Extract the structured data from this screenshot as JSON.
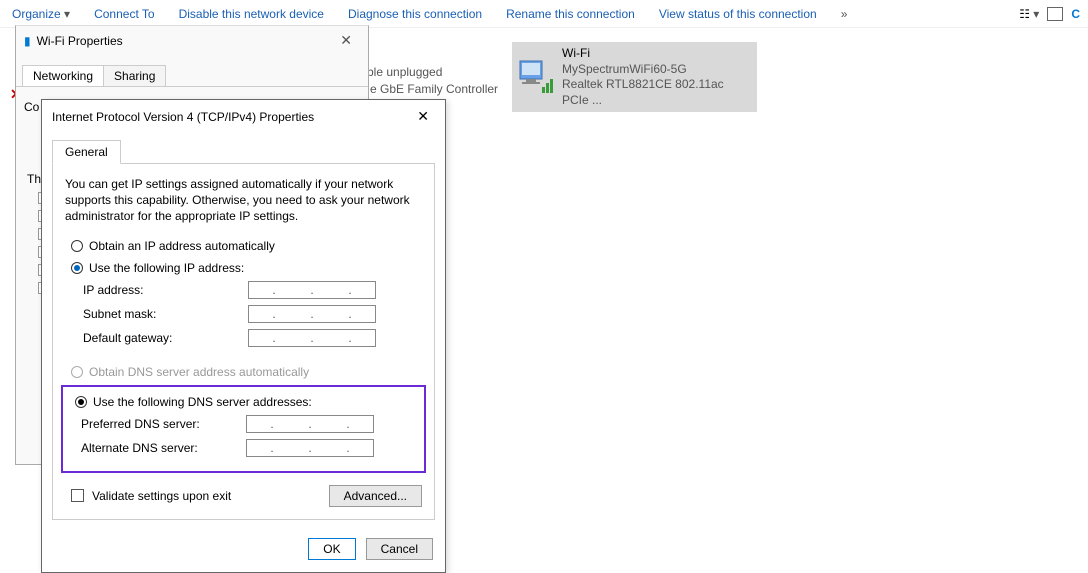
{
  "toolbar": {
    "organize": "Organize",
    "connect_to": "Connect To",
    "disable": "Disable this network device",
    "diagnose": "Diagnose this connection",
    "rename": "Rename this connection",
    "view_status": "View status of this connection",
    "more": "»"
  },
  "networks": {
    "partial1": "ble unplugged",
    "partial2": "e GbE Family Controller",
    "wifi": {
      "name": "Wi-Fi",
      "ssid": "MySpectrumWiFi60-5G",
      "adapter": "Realtek RTL8821CE 802.11ac PCIe ..."
    }
  },
  "wifi_dialog": {
    "title": "Wi-Fi Properties",
    "tabs": {
      "networking": "Networking",
      "sharing": "Sharing"
    },
    "co": "Co",
    "th": "Th"
  },
  "ipv4_dialog": {
    "title": "Internet Protocol Version 4 (TCP/IPv4) Properties",
    "tab_general": "General",
    "desc": "You can get IP settings assigned automatically if your network supports this capability. Otherwise, you need to ask your network administrator for the appropriate IP settings.",
    "radio_auto_ip": "Obtain an IP address automatically",
    "radio_static_ip": "Use the following IP address:",
    "ip_address": "IP address:",
    "subnet": "Subnet mask:",
    "gateway": "Default gateway:",
    "radio_auto_dns": "Obtain DNS server address automatically",
    "radio_static_dns": "Use the following DNS server addresses:",
    "preferred_dns": "Preferred DNS server:",
    "alternate_dns": "Alternate DNS server:",
    "validate": "Validate settings upon exit",
    "advanced": "Advanced...",
    "ok": "OK",
    "cancel": "Cancel",
    "ip_sep": "."
  }
}
